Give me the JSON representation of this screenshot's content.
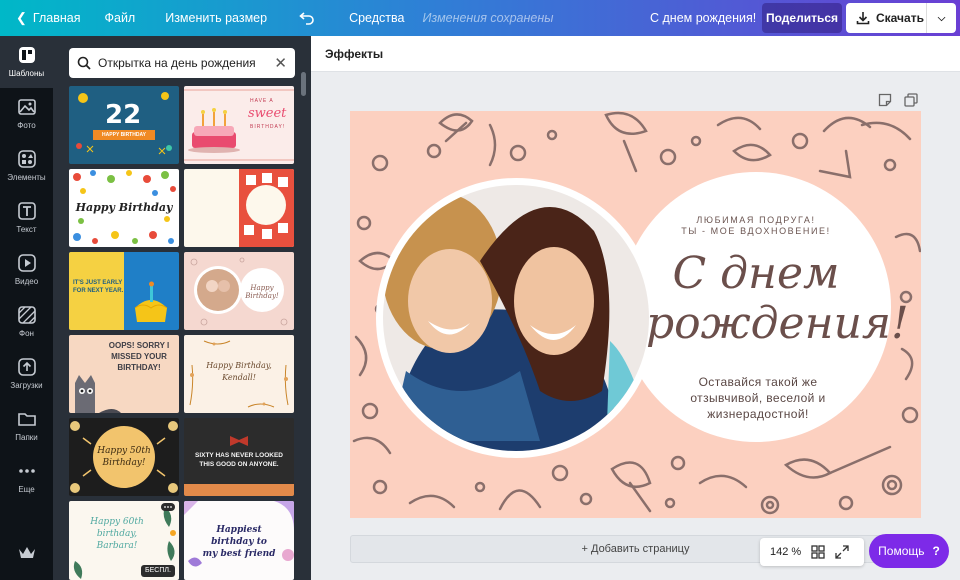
{
  "topbar": {
    "home": "Главная",
    "file": "Файл",
    "resize": "Изменить размер",
    "tools": "Средства",
    "status": "Изменения сохранены",
    "doc_title": "С днем рождения!",
    "share": "Поделиться",
    "download": "Скачать"
  },
  "rail": {
    "items": [
      {
        "label": "Шаблоны",
        "icon": "templates-icon"
      },
      {
        "label": "Фото",
        "icon": "photo-icon"
      },
      {
        "label": "Элементы",
        "icon": "elements-icon"
      },
      {
        "label": "Текст",
        "icon": "text-icon"
      },
      {
        "label": "Видео",
        "icon": "video-icon"
      },
      {
        "label": "Фон",
        "icon": "background-icon"
      },
      {
        "label": "Загрузки",
        "icon": "upload-icon"
      },
      {
        "label": "Папки",
        "icon": "folder-icon"
      },
      {
        "label": "Еще",
        "icon": "more-icon"
      }
    ]
  },
  "search": {
    "value": "Открытка на день рождения"
  },
  "thumbs": {
    "t1_number": "22",
    "t1_text": "HAPPY BIRTHDAY",
    "t2_a": "HAVE A",
    "t2_b": "sweet",
    "t2_c": "BIRTHDAY!",
    "t3": "Happy Birthday",
    "t5_a": "IT'S JUST EARLY",
    "t5_b": "FOR NEXT YEAR.",
    "t6": "Happy Birthday!",
    "t7_a": "OOPS! SORRY I",
    "t7_b": "MISSED YOUR",
    "t7_c": "BIRTHDAY!",
    "t8_a": "Happy Birthday,",
    "t8_b": "Kendall!",
    "t9_a": "Happy 50th",
    "t9_b": "Birthday!",
    "t10_a": "SIXTY HAS NEVER LOOKED",
    "t10_b": "THIS GOOD ON ANYONE.",
    "t11_a": "Happy 60th",
    "t11_b": "birthday,",
    "t11_c": "Barbara!",
    "t11_badge": "БЕСПЛ.",
    "t12_a": "Happiest",
    "t12_b": "birthday to",
    "t12_c": "my best friend"
  },
  "toolbar": {
    "effects": "Эффекты"
  },
  "card": {
    "small_line1": "ЛЮБИМАЯ ПОДРУГА!",
    "small_line2": "ТЫ - МОЕ ВДОХНОВЕНИЕ!",
    "script_line1": "С днем",
    "script_line2": "рождения!",
    "body_line1": "Оставайся такой же",
    "body_line2": "отзывчивой, веселой и",
    "body_line3": "жизнерадостной!"
  },
  "add_page": "+ Добавить страницу",
  "zoom": "142 %",
  "help": "Помощь",
  "help_q": "?",
  "colors": {
    "accent": "#7d2ae8",
    "card_bg": "#fcd0c0",
    "doodle": "#8a6f6b",
    "panel": "#293039"
  }
}
